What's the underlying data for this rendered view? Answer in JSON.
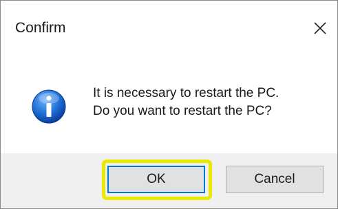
{
  "dialog": {
    "title": "Confirm",
    "close_icon": "close-icon",
    "icon": "information-icon",
    "message_lines": [
      "It is necessary to restart the PC.",
      "Do you want to restart the PC?"
    ],
    "buttons": {
      "ok_label": "OK",
      "cancel_label": "Cancel"
    },
    "highlight_color": "#e8e800",
    "focus_color": "#0078d7"
  }
}
